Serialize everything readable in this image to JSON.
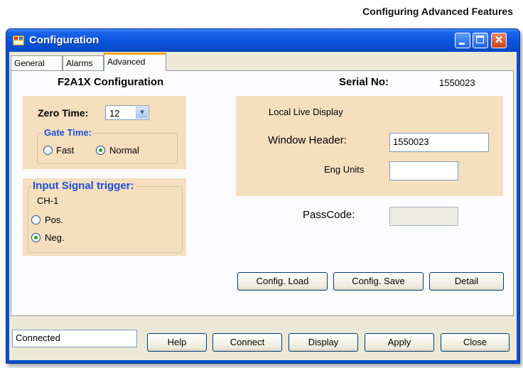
{
  "doc_heading": "Configuring Advanced Features",
  "window": {
    "title": "Configuration",
    "close_glyph": "✕"
  },
  "tabs": [
    {
      "label": "General"
    },
    {
      "label": "Alarms"
    },
    {
      "label": "Advanced"
    }
  ],
  "advanced": {
    "config_title": "F2A1X Configuration",
    "serial_label": "Serial No:",
    "serial_value": "1550023",
    "zero_time_label": "Zero Time:",
    "zero_time_value": "12",
    "gate_time_title": "Gate Time:",
    "gate_fast": "Fast",
    "gate_normal": "Normal",
    "gate_selected": "Normal",
    "input_trigger_title": "Input Signal trigger:",
    "channel_label": "CH-1",
    "trigger_pos": "Pos.",
    "trigger_neg": "Neg.",
    "trigger_selected": "Neg.",
    "live_display_label": "Local Live Display",
    "window_header_label": "Window Header:",
    "window_header_value": "1550023",
    "eng_units_label": "Eng Units",
    "eng_units_value": "",
    "passcode_label": "PassCode:",
    "passcode_value": "",
    "config_load": "Config. Load",
    "config_save": "Config. Save",
    "detail": "Detail"
  },
  "footer": {
    "status": "Connected",
    "help": "Help",
    "connect": "Connect",
    "display": "Display",
    "apply": "Apply",
    "close": "Close"
  },
  "colors": {
    "panel_tan": "#f6dfbf",
    "group_title_blue": "#1b4fd6",
    "titlebar_blue": "#0a55dd",
    "active_tab_accent": "#f5a623"
  }
}
